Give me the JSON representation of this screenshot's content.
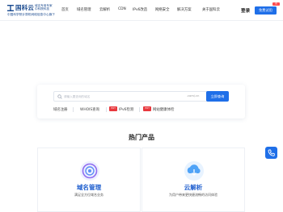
{
  "brand": {
    "name": "国科云",
    "slogan_line1": "域名专用专家",
    "slogan_line2": "中科院科技",
    "company": "中国科学院计算机网络信息中心旗下",
    "color": "#1a4a8f"
  },
  "nav": {
    "items": [
      "首页",
      "域名管理",
      "云解析",
      "CDN",
      "IPv6改造",
      "网络安全",
      "解决方案",
      "关于国科云"
    ]
  },
  "header": {
    "login_label": "登录",
    "free_trial_label": "免费试用",
    "badge_label": "新"
  },
  "search": {
    "placeholder": "请输入要查询的域名",
    "tld_value": ".com/.cn",
    "query_label": "立即查询"
  },
  "quick_links": {
    "items": [
      {
        "label": "域名注册"
      },
      {
        "label": "WHOIS查询"
      },
      {
        "label": "IPv6检测",
        "badge": "HOT"
      },
      {
        "label": "网站健康体检",
        "badge": "HOT"
      }
    ]
  },
  "hot_products": {
    "title": "热门产品",
    "cards": [
      {
        "title": "域名管理",
        "desc": "满足全方位域名业务",
        "icon": "domain-icon"
      },
      {
        "title": "云解析",
        "desc": "为用户带来更快捷流畅的访问体验",
        "icon": "cloud-dns-icon"
      }
    ]
  },
  "colors": {
    "accent": "#1f6fe8",
    "hot": "#e8383d"
  }
}
